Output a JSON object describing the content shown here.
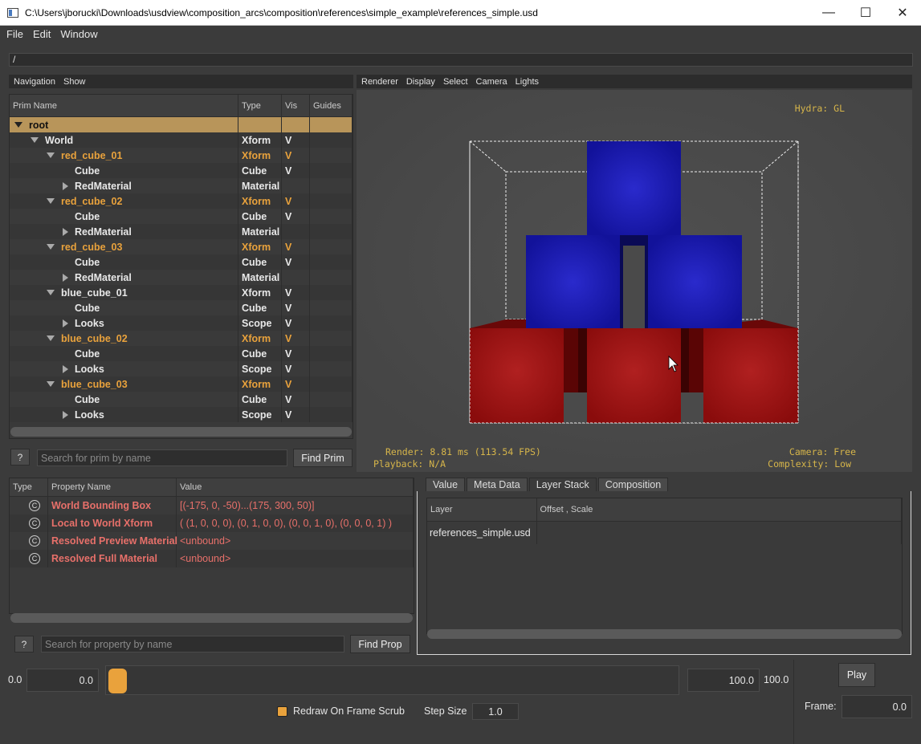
{
  "window": {
    "title": "C:\\Users\\jborucki\\Downloads\\usdview\\composition_arcs\\composition\\references\\simple_example\\references_simple.usd",
    "minimize": "—",
    "maximize": "☐",
    "close": "✕"
  },
  "menu": [
    "File",
    "Edit",
    "Window"
  ],
  "path": "/",
  "prim_panel": {
    "menu": [
      "Navigation",
      "Show"
    ],
    "columns": [
      "Prim Name",
      "Type",
      "Vis",
      "Guides"
    ],
    "rows": [
      {
        "name": "root",
        "type": "",
        "vis": "",
        "indent": 0,
        "arrow": "down",
        "style": "sel"
      },
      {
        "name": "World",
        "type": "Xform",
        "vis": "V",
        "indent": 1,
        "arrow": "down",
        "style": ""
      },
      {
        "name": "red_cube_01",
        "type": "Xform",
        "vis": "V",
        "indent": 2,
        "arrow": "down",
        "style": "ref"
      },
      {
        "name": "Cube",
        "type": "Cube",
        "vis": "V",
        "indent": 3,
        "arrow": "none",
        "style": ""
      },
      {
        "name": "RedMaterial",
        "type": "Material",
        "vis": "",
        "indent": 3,
        "arrow": "right",
        "style": ""
      },
      {
        "name": "red_cube_02",
        "type": "Xform",
        "vis": "V",
        "indent": 2,
        "arrow": "down",
        "style": "ref"
      },
      {
        "name": "Cube",
        "type": "Cube",
        "vis": "V",
        "indent": 3,
        "arrow": "none",
        "style": ""
      },
      {
        "name": "RedMaterial",
        "type": "Material",
        "vis": "",
        "indent": 3,
        "arrow": "right",
        "style": ""
      },
      {
        "name": "red_cube_03",
        "type": "Xform",
        "vis": "V",
        "indent": 2,
        "arrow": "down",
        "style": "ref"
      },
      {
        "name": "Cube",
        "type": "Cube",
        "vis": "V",
        "indent": 3,
        "arrow": "none",
        "style": ""
      },
      {
        "name": "RedMaterial",
        "type": "Material",
        "vis": "",
        "indent": 3,
        "arrow": "right",
        "style": ""
      },
      {
        "name": "blue_cube_01",
        "type": "Xform",
        "vis": "V",
        "indent": 2,
        "arrow": "down",
        "style": ""
      },
      {
        "name": "Cube",
        "type": "Cube",
        "vis": "V",
        "indent": 3,
        "arrow": "none",
        "style": ""
      },
      {
        "name": "Looks",
        "type": "Scope",
        "vis": "V",
        "indent": 3,
        "arrow": "right",
        "style": ""
      },
      {
        "name": "blue_cube_02",
        "type": "Xform",
        "vis": "V",
        "indent": 2,
        "arrow": "down",
        "style": "ref"
      },
      {
        "name": "Cube",
        "type": "Cube",
        "vis": "V",
        "indent": 3,
        "arrow": "none",
        "style": ""
      },
      {
        "name": "Looks",
        "type": "Scope",
        "vis": "V",
        "indent": 3,
        "arrow": "right",
        "style": ""
      },
      {
        "name": "blue_cube_03",
        "type": "Xform",
        "vis": "V",
        "indent": 2,
        "arrow": "down",
        "style": "ref"
      },
      {
        "name": "Cube",
        "type": "Cube",
        "vis": "V",
        "indent": 3,
        "arrow": "none",
        "style": ""
      },
      {
        "name": "Looks",
        "type": "Scope",
        "vis": "V",
        "indent": 3,
        "arrow": "right",
        "style": ""
      }
    ],
    "help": "?",
    "search_placeholder": "Search for prim by name",
    "find_button": "Find Prim"
  },
  "viewport": {
    "menu": [
      "Renderer",
      "Display",
      "Select",
      "Camera",
      "Lights"
    ],
    "renderer": "Hydra: GL",
    "render_stats": "Render: 8.81 ms (113.54 FPS)",
    "playback": "Playback: N/A",
    "camera": "Camera: Free",
    "complexity": "Complexity: Low"
  },
  "properties": {
    "columns": [
      "Type",
      "Property Name",
      "Value"
    ],
    "rows": [
      {
        "icon": "C",
        "name": "World Bounding Box",
        "value": "[(-175, 0, -50)...(175, 300, 50)]"
      },
      {
        "icon": "C",
        "name": "Local to World Xform",
        "value": "( (1, 0, 0, 0), (0, 1, 0, 0), (0, 0, 1, 0), (0, 0, 0, 1) )"
      },
      {
        "icon": "C",
        "name": "Resolved Preview Material",
        "value": "<unbound>"
      },
      {
        "icon": "C",
        "name": "Resolved Full Material",
        "value": "<unbound>"
      }
    ],
    "help": "?",
    "search_placeholder": "Search for property by name",
    "find_button": "Find Prop"
  },
  "inspector": {
    "tabs": [
      "Value",
      "Meta Data",
      "Layer Stack",
      "Composition"
    ],
    "active_tab": 2,
    "columns": [
      "Layer",
      "Offset , Scale"
    ],
    "rows": [
      {
        "layer": "references_simple.usd",
        "offset": ""
      }
    ]
  },
  "timeline": {
    "start_label": "0.0",
    "start_value": "0.0",
    "end_value": "100.0",
    "end_label": "100.0",
    "play": "Play",
    "redraw_label": "Redraw On Frame Scrub",
    "redraw_checked": true,
    "step_label": "Step Size",
    "step_value": "1.0",
    "frame_label": "Frame:",
    "frame_value": "0.0"
  },
  "colors": {
    "accent": "#e9a23c",
    "selection": "#b8955a",
    "property": "#e8706a",
    "cube_red": "#a01212",
    "cube_blue": "#1a1ab0"
  }
}
